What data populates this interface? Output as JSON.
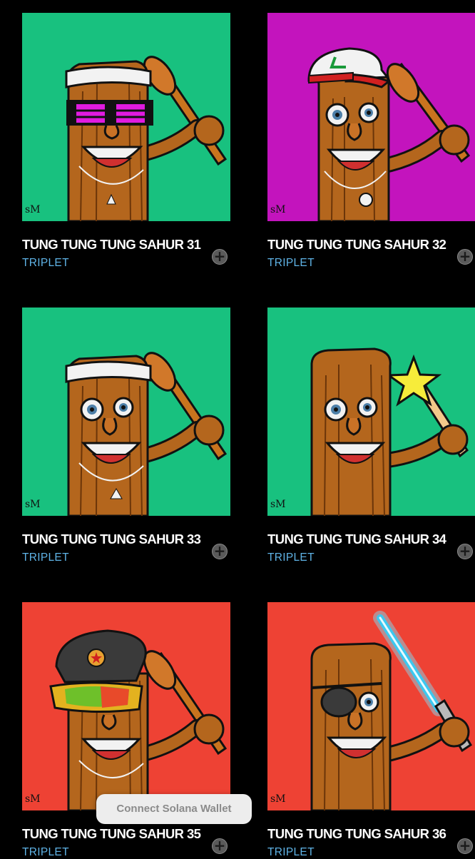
{
  "cards": [
    {
      "title": "TUNG TUNG TUNG SAHUR 31",
      "subtitle": "TRIPLET",
      "bg": "#18c17f",
      "accessory": "pixel-sunglasses",
      "item": "baseball-bat"
    },
    {
      "title": "TUNG TUNG TUNG SAHUR 32",
      "subtitle": "TRIPLET",
      "bg": "#c314bd",
      "accessory": "cap",
      "item": "baseball-bat"
    },
    {
      "title": "TUNG TUNG TUNG SAHUR 33",
      "subtitle": "TRIPLET",
      "bg": "#18c17f",
      "accessory": "headband",
      "item": "baseball-bat"
    },
    {
      "title": "TUNG TUNG TUNG SAHUR 34",
      "subtitle": "TRIPLET",
      "bg": "#18c17f",
      "accessory": "none",
      "item": "star-wand"
    },
    {
      "title": "TUNG TUNG TUNG SAHUR 35",
      "subtitle": "TRIPLET",
      "bg": "#ee4234",
      "accessory": "ushanka-visor",
      "item": "baseball-bat"
    },
    {
      "title": "TUNG TUNG TUNG SAHUR 36",
      "subtitle": "TRIPLET",
      "bg": "#ee4234",
      "accessory": "eyepatch",
      "item": "lightsaber"
    }
  ],
  "add_icon": "plus-circle-icon",
  "wallet_button": {
    "label": "Connect Solana Wallet"
  },
  "colors": {
    "page_bg": "#000000",
    "title": "#ffffff",
    "subtitle": "#5fb3e6",
    "wood": "#b4661d",
    "wood_dark": "#6b3509"
  }
}
